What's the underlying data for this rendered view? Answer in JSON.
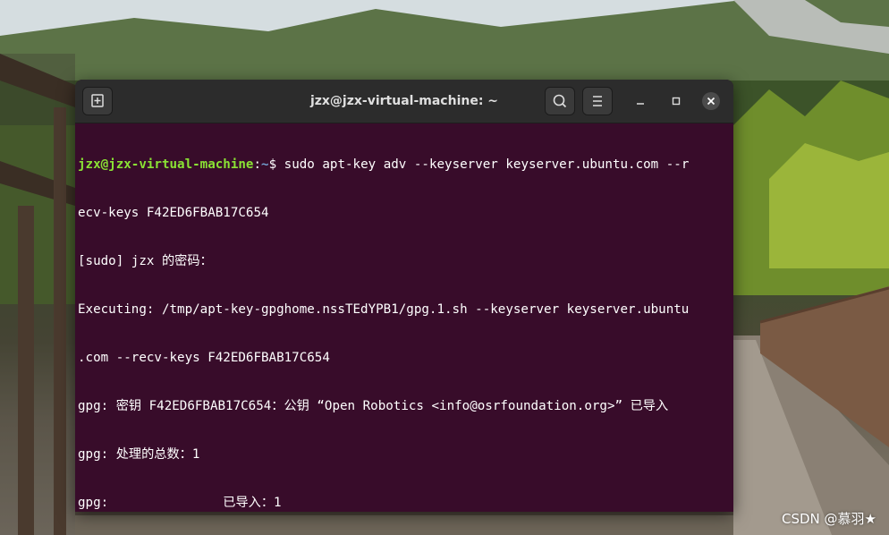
{
  "window": {
    "title": "jzx@jzx-virtual-machine: ~",
    "buttons": {
      "new_tab_icon": "new-tab-icon",
      "search_icon": "search-icon",
      "menu_icon": "hamburger-menu-icon",
      "minimize_icon": "minimize-icon",
      "maximize_icon": "maximize-icon",
      "close_icon": "close-icon"
    }
  },
  "terminal": {
    "prompt_user": "jzx@jzx-virtual-machine",
    "prompt_sep": ":",
    "prompt_path": "~",
    "prompt_symbol": "$ ",
    "command_part1": "sudo apt-key adv --keyserver keyserver.ubuntu.com --r",
    "command_part2": "ecv-keys F42ED6FBAB17C654",
    "output": [
      "[sudo] jzx 的密码：",
      "Executing: /tmp/apt-key-gpghome.nssTEdYPB1/gpg.1.sh --keyserver keyserver.ubuntu",
      ".com --recv-keys F42ED6FBAB17C654",
      "gpg: 密钥 F42ED6FBAB17C654：公钥 “Open Robotics <info@osrfoundation.org>” 已导入",
      "gpg: 处理的总数：1",
      "gpg:               已导入：1"
    ]
  },
  "watermark": "CSDN @慕羽★",
  "colors": {
    "terminal_bg": "#380c2a",
    "titlebar_bg": "#2c2c2c",
    "prompt_user": "#8ae234",
    "prompt_path": "#729fcf",
    "text": "#ffffff"
  }
}
